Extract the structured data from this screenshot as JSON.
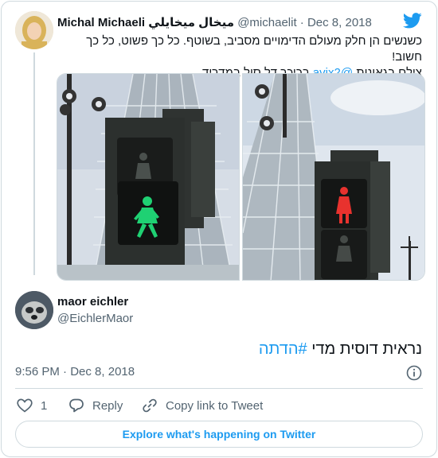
{
  "parent": {
    "name": "Michal Michaeli ميخال ميخايلي",
    "handle": "@michaelit",
    "separator": "·",
    "date": "Dec 8, 2018",
    "text_line1": "כשנשים הן חלק מעולם הדימויים מסביב, בשוטף. כל כך פשוט, כל כך חשוב!",
    "text_line2_prefix": "צילם בגאונות ",
    "mention": "@avix2",
    "text_line2_suffix": " בכיכר דל סול במדריד"
  },
  "tweet": {
    "name": "maor eichler",
    "handle": "@EichlerMaor",
    "text_prefix": "נראית דוסית מדי ",
    "hashtag": "#הדתה",
    "time": "9:56 PM",
    "separator": "·",
    "date": "Dec 8, 2018"
  },
  "actions": {
    "like_count": "1",
    "reply_label": "Reply",
    "copy_label": "Copy link to Tweet"
  },
  "explore_label": "Explore what's happening on Twitter",
  "colors": {
    "accent": "#1d9bf0",
    "muted": "#536471",
    "border": "#cfd9de",
    "walk_green": "#1fd173",
    "stop_red": "#e8322e"
  },
  "icons": [
    "twitter-bird-icon",
    "info-icon",
    "heart-icon",
    "reply-bubble-icon",
    "link-icon"
  ]
}
